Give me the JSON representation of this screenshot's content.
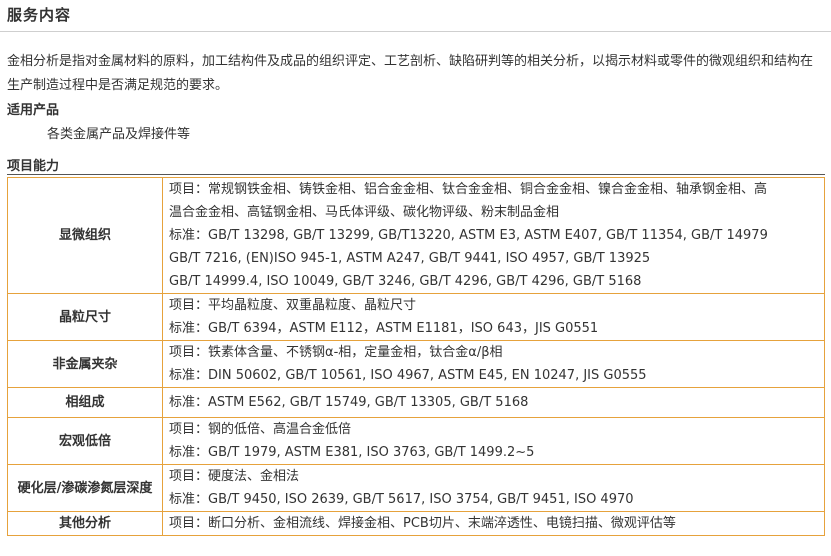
{
  "section_title": "服务内容",
  "intro": "金相分析是指对金属材料的原料，加工结构件及成品的组织评定、工艺剖析、缺陷研判等的相关分析，以揭示材料或零件的微观组织和结构在生产制造过程中是否满足规范的要求。",
  "applicable": {
    "label": "适用产品",
    "text": "各类金属产品及焊接件等"
  },
  "capability": {
    "label": "项目能力",
    "rows": [
      {
        "name": "显微组织",
        "lines": [
          "项目：常规钢铁金相、铸铁金相、铝合金金相、钛合金金相、铜合金金相、镍合金金相、轴承钢金相、高",
          "温合金金相、高锰钢金相、马氏体评级、碳化物评级、粉末制品金相",
          "标准：GB/T 13298, GB/T 13299, GB/T13220, ASTM E3, ASTM E407, GB/T 11354, GB/T 14979",
          "GB/T 7216, (EN)ISO 945-1, ASTM A247, GB/T 9441, ISO 4957, GB/T 13925",
          "GB/T 14999.4, ISO 10049, GB/T 3246, GB/T 4296, GB/T 4296, GB/T 5168"
        ]
      },
      {
        "name": "晶粒尺寸",
        "lines": [
          "项目：平均晶粒度、双重晶粒度、晶粒尺寸",
          "标准：GB/T 6394，ASTM E112，ASTM E1181，ISO 643，JIS G0551"
        ]
      },
      {
        "name": "非金属夹杂",
        "lines": [
          "项目：铁素体含量、不锈钢α-相，定量金相，钛合金α/β相",
          "标准：DIN 50602, GB/T 10561, ISO 4967, ASTM E45, EN 10247, JIS G0555"
        ]
      },
      {
        "name": "相组成",
        "lines": [
          "标准：ASTM E562, GB/T 15749, GB/T 13305, GB/T 5168"
        ]
      },
      {
        "name": "宏观低倍",
        "lines": [
          "项目：钢的低倍、高温合金低倍",
          "标准：GB/T 1979, ASTM E381, ISO 3763, GB/T 1499.2~5"
        ]
      },
      {
        "name": "硬化层/渗碳渗氮层深度",
        "lines": [
          "项目：硬度法、金相法",
          "标准：GB/T 9450, ISO 2639, GB/T 5617, ISO 3754, GB/T 9451, ISO 4970"
        ]
      },
      {
        "name": "其他分析",
        "lines": [
          "项目：断口分析、金相流线、焊接金相、PCB切片、末端淬透性、电镜扫描、微观评估等"
        ]
      }
    ]
  },
  "colors": {
    "border": "#e6a23c",
    "text": "#333333"
  }
}
